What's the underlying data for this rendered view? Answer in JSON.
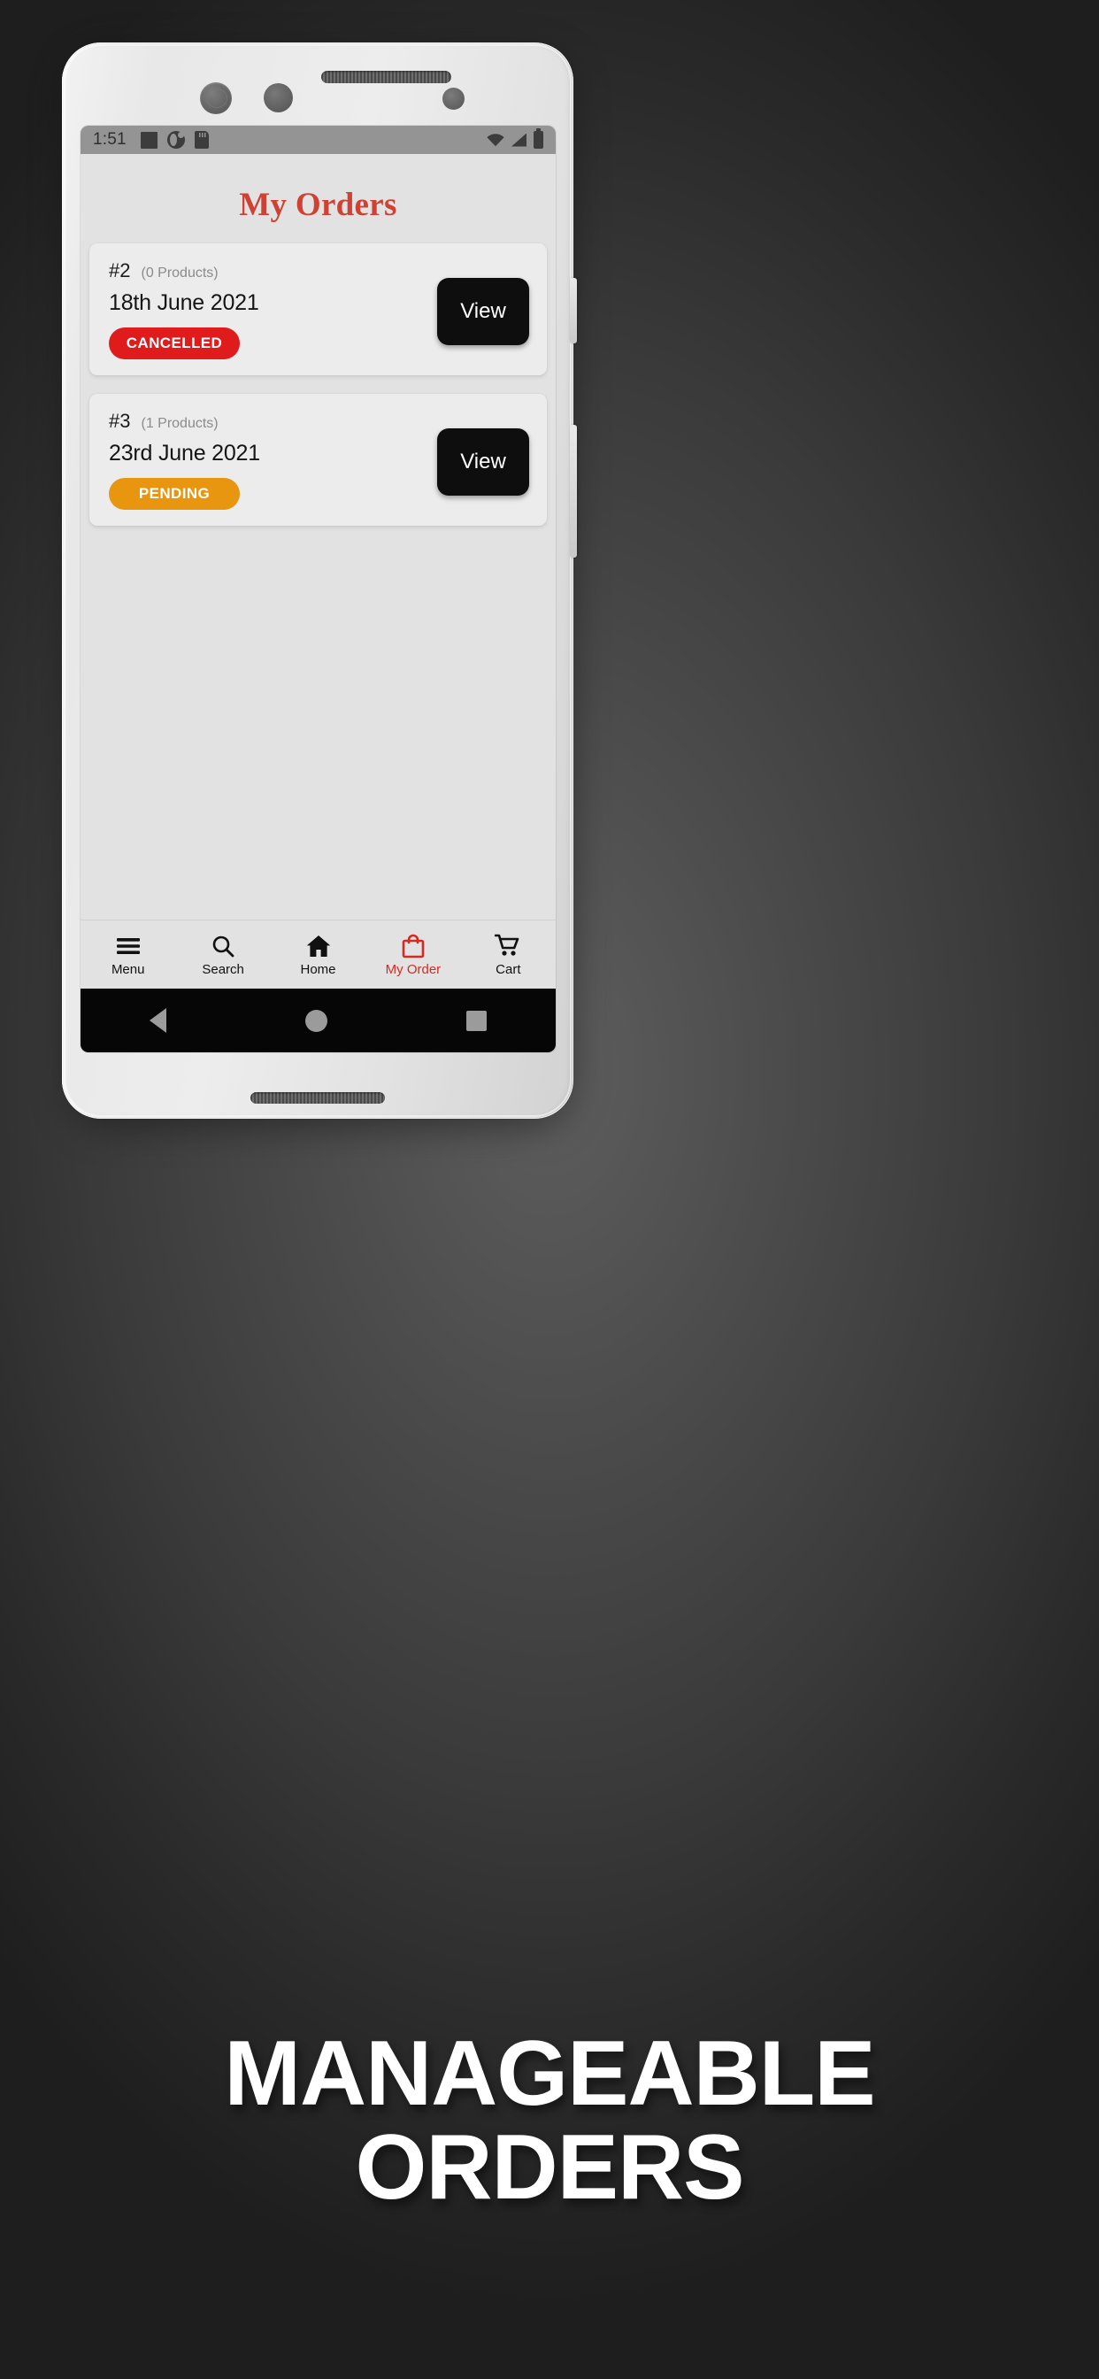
{
  "phone": {
    "status_bar": {
      "time": "1:51",
      "left_icons": [
        "square-notification-icon",
        "contrast-circle-icon",
        "sd-card-icon"
      ],
      "right_icons": [
        "wifi-icon",
        "signal-icon",
        "battery-icon"
      ]
    },
    "android_nav": {
      "back": "back-triangle",
      "home": "home-circle",
      "recents": "recents-square"
    }
  },
  "app": {
    "title": "My Orders",
    "title_color": "#cf4233",
    "orders": [
      {
        "number": "#2",
        "products": "(0 Products)",
        "date": "18th June 2021",
        "status": "CANCELLED",
        "status_color": "#e01b1b",
        "action": "View"
      },
      {
        "number": "#3",
        "products": "(1 Products)",
        "date": "23rd June 2021",
        "status": "PENDING",
        "status_color": "#e8950f",
        "action": "View"
      }
    ],
    "bottom_nav": {
      "active_color": "#d42a22",
      "items": [
        {
          "label": "Menu",
          "icon": "hamburger-menu-icon",
          "active": false
        },
        {
          "label": "Search",
          "icon": "search-icon",
          "active": false
        },
        {
          "label": "Home",
          "icon": "home-icon",
          "active": false
        },
        {
          "label": "My Order",
          "icon": "shopping-bag-icon",
          "active": true
        },
        {
          "label": "Cart",
          "icon": "shopping-cart-icon",
          "active": false
        }
      ]
    }
  },
  "caption": {
    "line1": "MANAGEABLE",
    "line2": "ORDERS"
  }
}
